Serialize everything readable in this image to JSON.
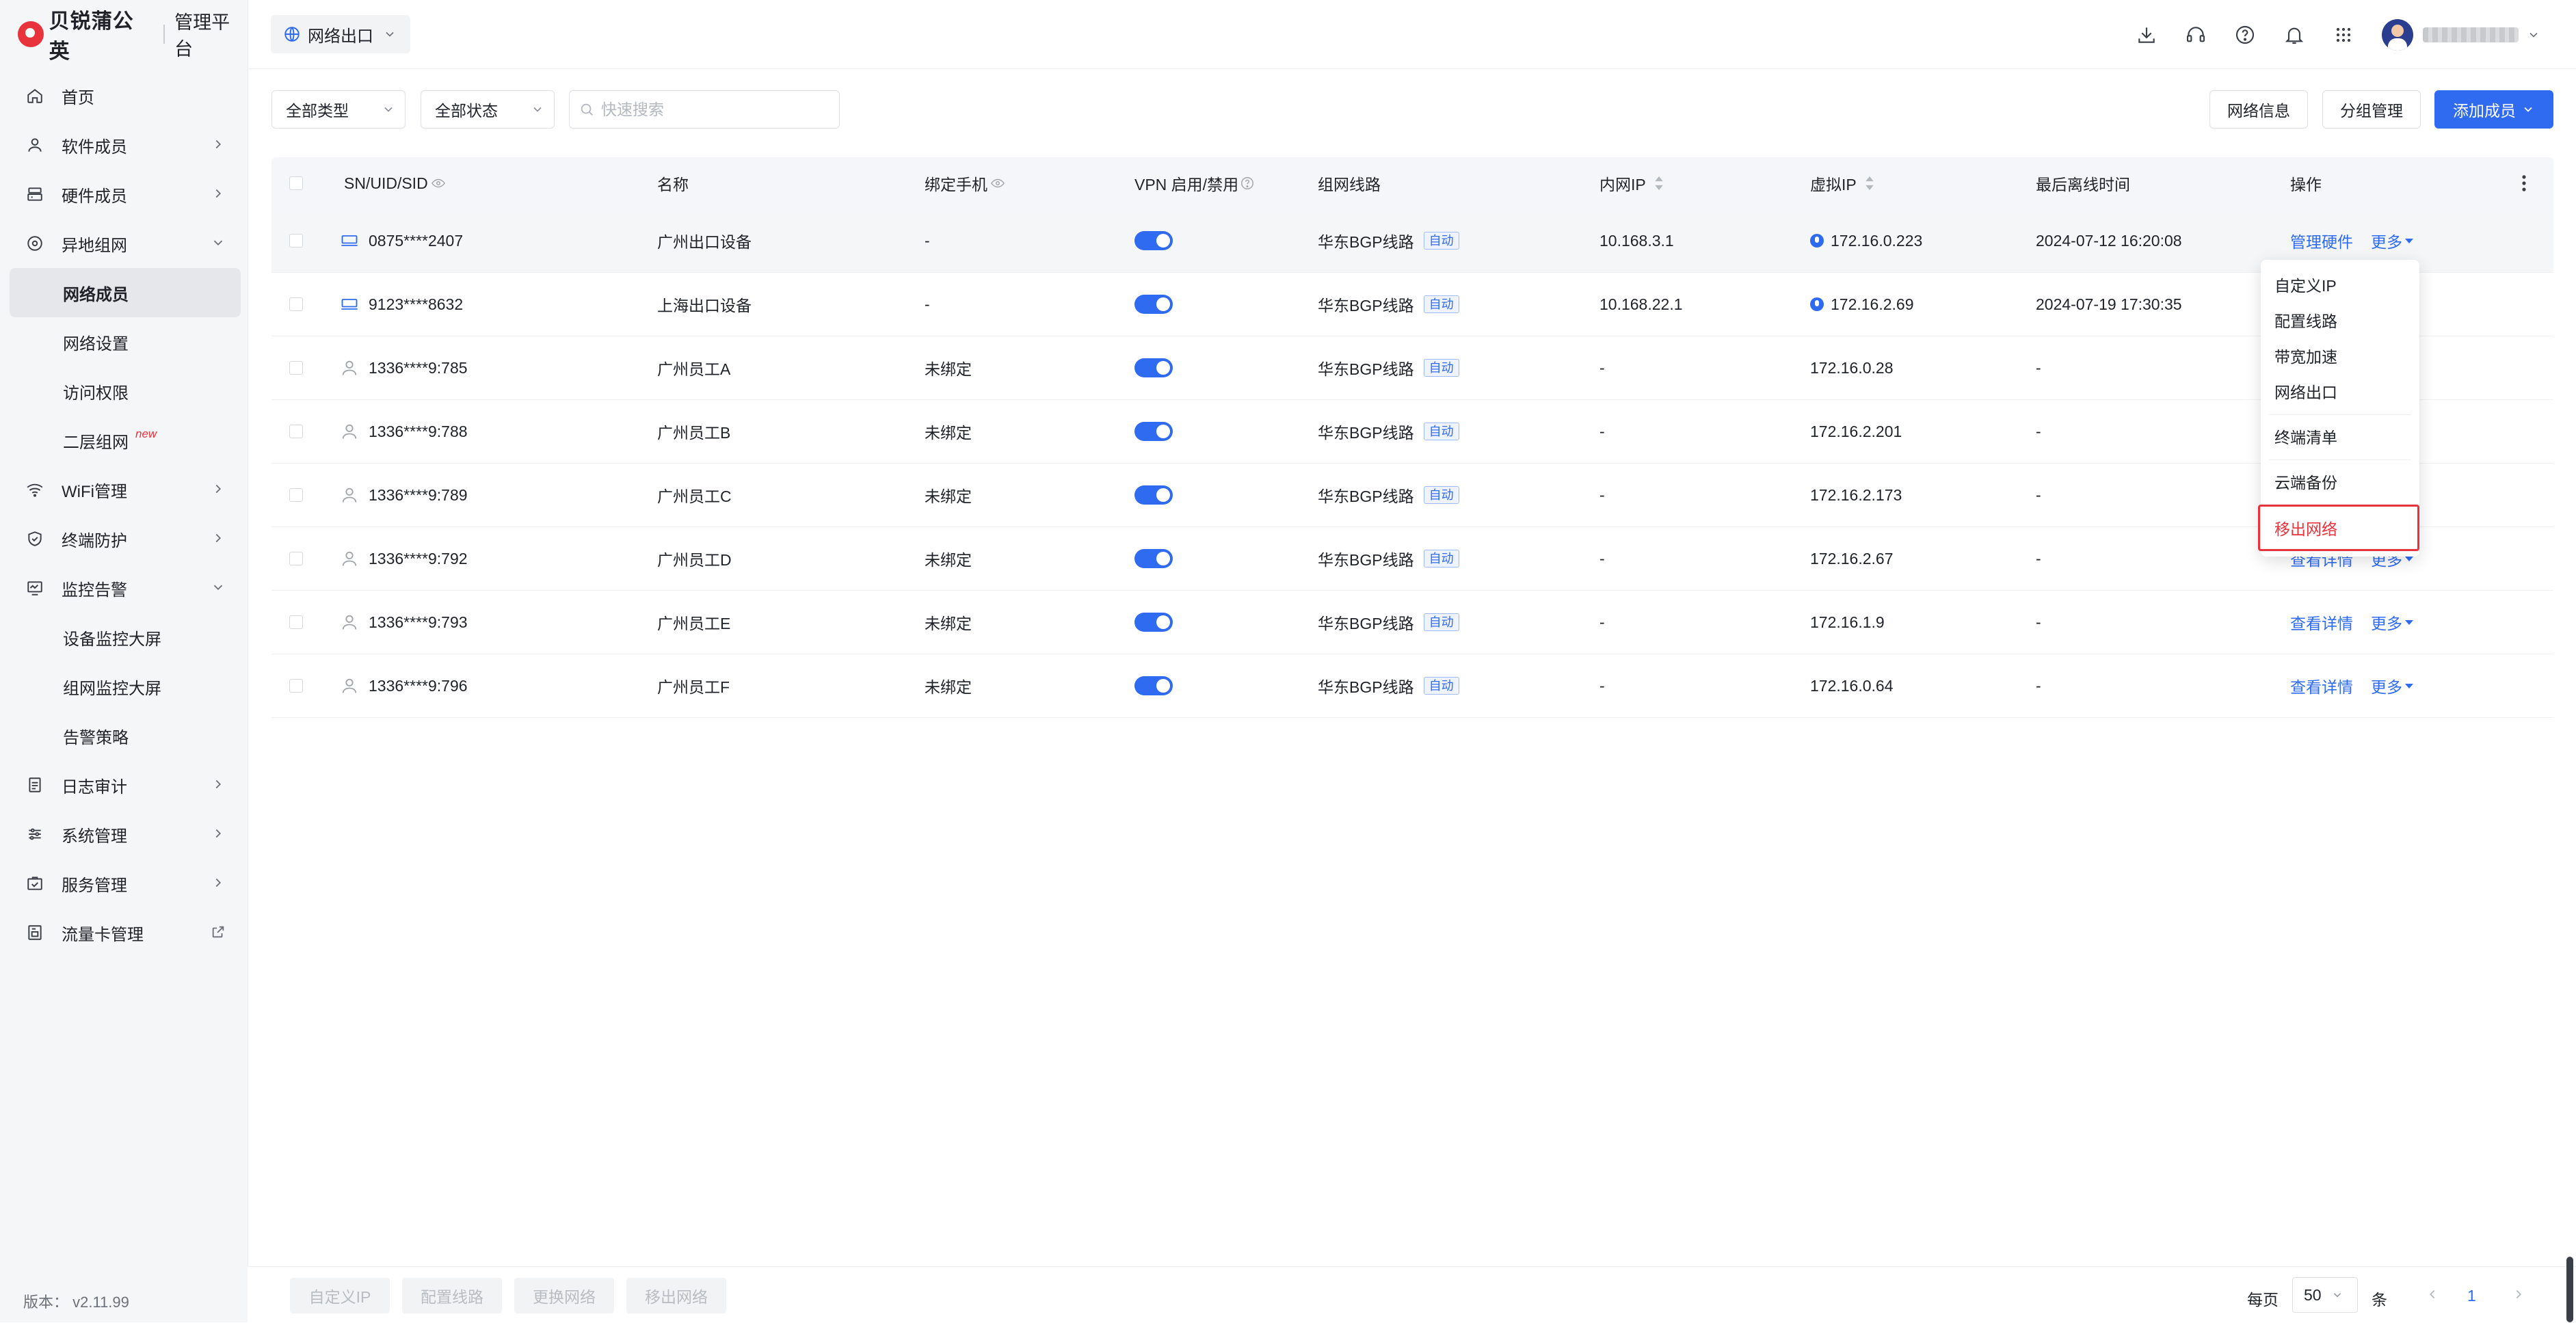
{
  "brand": {
    "name": "贝锐蒲公英",
    "subtitle": "管理平台"
  },
  "sidebar": {
    "items": [
      {
        "label": "首页",
        "icon": "home-icon"
      },
      {
        "label": "软件成员",
        "icon": "user-icon",
        "arrow": "right"
      },
      {
        "label": "硬件成员",
        "icon": "hardware-icon",
        "arrow": "right"
      },
      {
        "label": "异地组网",
        "icon": "network-icon",
        "arrow": "down",
        "children": [
          {
            "label": "网络成员",
            "active": true
          },
          {
            "label": "网络设置"
          },
          {
            "label": "访问权限"
          },
          {
            "label": "二层组网",
            "badge": "new"
          }
        ]
      },
      {
        "label": "WiFi管理",
        "icon": "wifi-icon",
        "arrow": "right"
      },
      {
        "label": "终端防护",
        "icon": "shield-icon",
        "arrow": "right"
      },
      {
        "label": "监控告警",
        "icon": "monitor-icon",
        "arrow": "down",
        "children": [
          {
            "label": "设备监控大屏"
          },
          {
            "label": "组网监控大屏"
          },
          {
            "label": "告警策略"
          }
        ]
      },
      {
        "label": "日志审计",
        "icon": "log-icon",
        "arrow": "right"
      },
      {
        "label": "系统管理",
        "icon": "settings-sliders-icon",
        "arrow": "right"
      },
      {
        "label": "服务管理",
        "icon": "service-icon",
        "arrow": "right"
      },
      {
        "label": "流量卡管理",
        "icon": "sim-card-icon",
        "arrow": "external"
      }
    ],
    "version": "版本：  v2.11.99"
  },
  "header": {
    "network_select": "网络出口",
    "icons": [
      "download-icon",
      "headset-icon",
      "help-icon",
      "bell-icon",
      "apps-grid-icon"
    ]
  },
  "toolbar": {
    "filter_type": "全部类型",
    "filter_status": "全部状态",
    "search_placeholder": "快速搜索",
    "network_info": "网络信息",
    "group_manage": "分组管理",
    "add_member": "添加成员"
  },
  "table": {
    "headers": {
      "id": "SN/UID/SID",
      "name": "名称",
      "phone": "绑定手机",
      "vpn": "VPN 启用/禁用",
      "route": "组网线路",
      "lan_ip": "内网IP",
      "virtual_ip": "虚拟IP",
      "last_offline": "最后离线时间",
      "actions": "操作"
    },
    "rows": [
      {
        "id": "0875****2407",
        "kind": "hardware",
        "name": "广州出口设备",
        "phone": "-",
        "vpn": true,
        "route": "华东BGP线路",
        "route_tag": "自动",
        "lan_ip": "10.168.3.1",
        "virtual_ip": "172.16.0.223",
        "vip_icon": true,
        "last_offline": "2024-07-12 16:20:08",
        "action": "管理硬件",
        "more": "更多"
      },
      {
        "id": "9123****8632",
        "kind": "hardware",
        "name": "上海出口设备",
        "phone": "-",
        "vpn": true,
        "route": "华东BGP线路",
        "route_tag": "自动",
        "lan_ip": "10.168.22.1",
        "virtual_ip": "172.16.2.69",
        "vip_icon": true,
        "last_offline": "2024-07-19 17:30:35",
        "action": "",
        "more": ""
      },
      {
        "id": "1336****9:785",
        "kind": "user",
        "name": "广州员工A",
        "phone": "未绑定",
        "vpn": true,
        "route": "华东BGP线路",
        "route_tag": "自动",
        "lan_ip": "-",
        "virtual_ip": "172.16.0.28",
        "vip_icon": false,
        "last_offline": "-",
        "action": "",
        "more": ""
      },
      {
        "id": "1336****9:788",
        "kind": "user",
        "name": "广州员工B",
        "phone": "未绑定",
        "vpn": true,
        "route": "华东BGP线路",
        "route_tag": "自动",
        "lan_ip": "-",
        "virtual_ip": "172.16.2.201",
        "vip_icon": false,
        "last_offline": "-",
        "action": "",
        "more": ""
      },
      {
        "id": "1336****9:789",
        "kind": "user",
        "name": "广州员工C",
        "phone": "未绑定",
        "vpn": true,
        "route": "华东BGP线路",
        "route_tag": "自动",
        "lan_ip": "-",
        "virtual_ip": "172.16.2.173",
        "vip_icon": false,
        "last_offline": "-",
        "action": "",
        "more": ""
      },
      {
        "id": "1336****9:792",
        "kind": "user",
        "name": "广州员工D",
        "phone": "未绑定",
        "vpn": true,
        "route": "华东BGP线路",
        "route_tag": "自动",
        "lan_ip": "-",
        "virtual_ip": "172.16.2.67",
        "vip_icon": false,
        "last_offline": "-",
        "action": "查看详情",
        "more": "更多"
      },
      {
        "id": "1336****9:793",
        "kind": "user",
        "name": "广州员工E",
        "phone": "未绑定",
        "vpn": true,
        "route": "华东BGP线路",
        "route_tag": "自动",
        "lan_ip": "-",
        "virtual_ip": "172.16.1.9",
        "vip_icon": false,
        "last_offline": "-",
        "action": "查看详情",
        "more": "更多"
      },
      {
        "id": "1336****9:796",
        "kind": "user",
        "name": "广州员工F",
        "phone": "未绑定",
        "vpn": true,
        "route": "华东BGP线路",
        "route_tag": "自动",
        "lan_ip": "-",
        "virtual_ip": "172.16.0.64",
        "vip_icon": false,
        "last_offline": "-",
        "action": "查看详情",
        "more": "更多"
      }
    ]
  },
  "dropdown": {
    "items": [
      "自定义IP",
      "配置线路",
      "带宽加速",
      "网络出口",
      "终端清单",
      "云端备份",
      "移出网络"
    ],
    "danger_item": "移出网络"
  },
  "footer": {
    "batch_buttons": [
      "自定义IP",
      "配置线路",
      "更换网络",
      "移出网络"
    ],
    "per_page_label": "每页",
    "page_size": "50",
    "unit": "条",
    "current_page": "1"
  },
  "colors": {
    "accent": "#2f6bf0",
    "danger": "#e8323c",
    "sidebar_bg": "#f5f6f8"
  }
}
